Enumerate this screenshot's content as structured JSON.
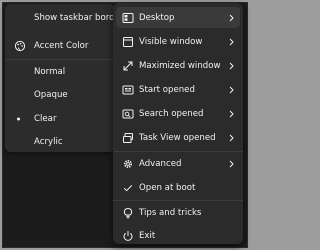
{
  "submenu": {
    "items": [
      {
        "label": "Show taskbar border",
        "icon": ""
      },
      {
        "label": "Accent Color",
        "icon": "palette-icon"
      },
      {
        "label": "Normal",
        "icon": ""
      },
      {
        "label": "Opaque",
        "icon": ""
      },
      {
        "label": "Clear",
        "icon": "bullet-icon",
        "selected": true
      },
      {
        "label": "Acrylic",
        "icon": ""
      }
    ]
  },
  "menu": {
    "items": [
      {
        "label": "Desktop",
        "icon": "desktop-icon",
        "submenu": true,
        "highlighted": true
      },
      {
        "label": "Visible window",
        "icon": "window-icon",
        "submenu": true
      },
      {
        "label": "Maximized window",
        "icon": "maximize-icon",
        "submenu": true
      },
      {
        "label": "Start opened",
        "icon": "start-icon",
        "submenu": true
      },
      {
        "label": "Search opened",
        "icon": "search-icon",
        "submenu": true
      },
      {
        "label": "Task View opened",
        "icon": "task-view-icon",
        "submenu": true
      },
      {
        "label": "Advanced",
        "icon": "gear-icon",
        "submenu": true
      },
      {
        "label": "Open at boot",
        "icon": "checkmark-icon",
        "checked": true
      },
      {
        "label": "Tips and tricks",
        "icon": "lightbulb-icon"
      },
      {
        "label": "Exit",
        "icon": "power-icon"
      }
    ]
  },
  "colors": {
    "menu_bg": "#2b2b2b",
    "highlight": "#3a3a3a",
    "text": "#f2f2f2",
    "backdrop": "#9d9d9d"
  }
}
